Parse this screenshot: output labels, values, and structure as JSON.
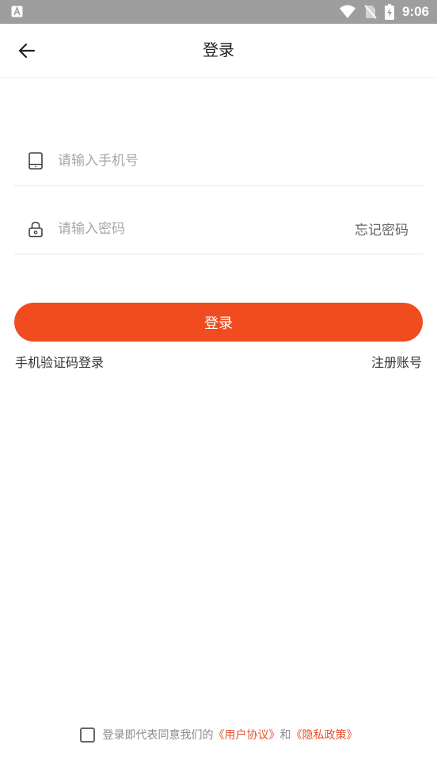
{
  "status_bar": {
    "time": "9:06",
    "icons": [
      "app-notification-icon",
      "wifi-icon",
      "no-sim-icon",
      "battery-charging-icon"
    ]
  },
  "header": {
    "title": "登录",
    "back_icon": "arrow-left-icon"
  },
  "form": {
    "phone": {
      "icon": "phone-icon",
      "value": "",
      "placeholder": "请输入手机号"
    },
    "password": {
      "icon": "lock-icon",
      "value": "",
      "placeholder": "请输入密码",
      "forgot_label": "忘记密码"
    },
    "login_label": "登录",
    "sms_login_label": "手机验证码登录",
    "register_label": "注册账号"
  },
  "agreement": {
    "checked": false,
    "prefix": "登录即代表同意我们的",
    "user_agreement": "《用户协议》",
    "conjunction": "和",
    "privacy_policy": "《隐私政策》"
  },
  "colors": {
    "accent": "#f04c1f",
    "link": "#e8502a",
    "status_bar": "#9e9e9e"
  }
}
